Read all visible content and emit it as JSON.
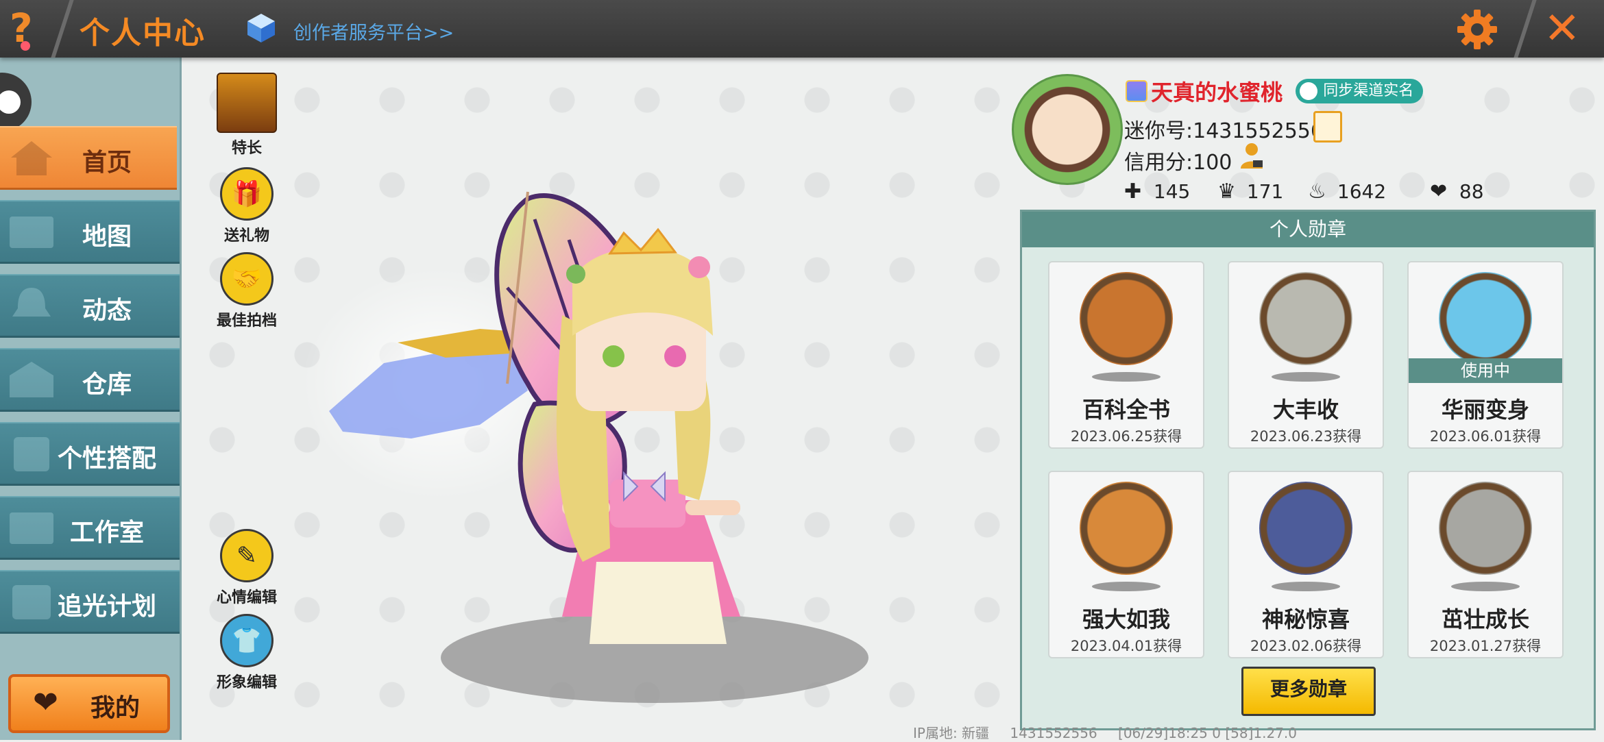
{
  "topbar": {
    "help_glyph": "?",
    "title": "个人中心",
    "creator_link": "创作者服务平台>>",
    "close_glyph": "✕"
  },
  "sidebar": {
    "items": [
      {
        "label": "首页",
        "active": true
      },
      {
        "label": "地图",
        "active": false
      },
      {
        "label": "动态",
        "active": false
      },
      {
        "label": "仓库",
        "active": false
      },
      {
        "label": "个性搭配",
        "active": false
      },
      {
        "label": "工作室",
        "active": false
      },
      {
        "label": "追光计划",
        "active": false
      }
    ],
    "mine_label": "我的"
  },
  "actions": {
    "special": "特长",
    "gift": "送礼物",
    "partner": "最佳拍档",
    "mood": "心情编辑",
    "appearance": "形象编辑"
  },
  "profile": {
    "nickname": "天真的水蜜桃",
    "sync_badge": "同步渠道实名",
    "mini_id": "迷你号:1431552556",
    "credit": "信用分:100",
    "stats": {
      "friends": "145",
      "fans": "171",
      "popularity": "1642",
      "likes": "88"
    }
  },
  "medals": {
    "title": "个人勋章",
    "in_use_label": "使用中",
    "items": [
      {
        "name": "百科全书",
        "date": "2023.06.25获得",
        "color": "#c9752f"
      },
      {
        "name": "大丰收",
        "date": "2023.06.23获得",
        "color": "#b9b9b0"
      },
      {
        "name": "华丽变身",
        "date": "2023.06.01获得",
        "color": "#6cc6ea",
        "in_use": true
      },
      {
        "name": "强大如我",
        "date": "2023.04.01获得",
        "color": "#d8893a"
      },
      {
        "name": "神秘惊喜",
        "date": "2023.02.06获得",
        "color": "#4d5c9a"
      },
      {
        "name": "茁壮成长",
        "date": "2023.01.27获得",
        "color": "#a7a7a2"
      }
    ],
    "more_button": "更多勋章"
  },
  "footer": {
    "ip": "IP属地: 新疆",
    "uid": "1431552556",
    "build": "[06/29]18:25 0  [58]1.27.0"
  },
  "colors": {
    "accent_orange": "#f58a24",
    "teal": "#5a8f88",
    "nickname_red": "#e0242c"
  }
}
